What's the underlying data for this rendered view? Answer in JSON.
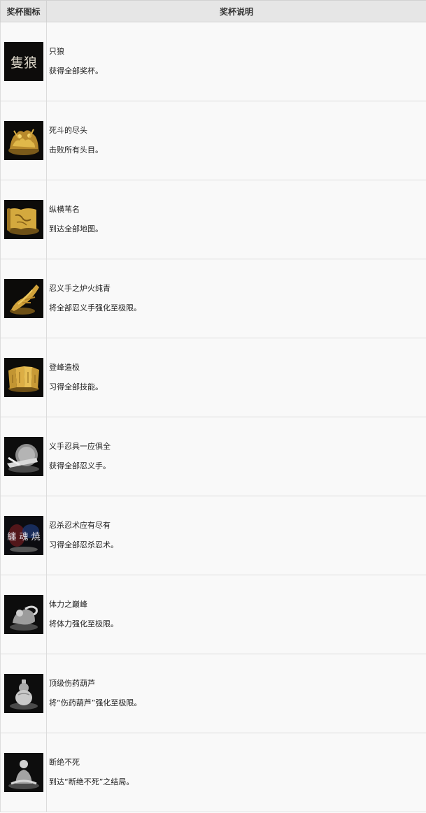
{
  "table": {
    "headers": {
      "icon": "奖杯图标",
      "desc": "奖杯说明"
    },
    "rows": [
      {
        "icon": "calligraphy-logo-icon",
        "icon_text": "隻狼",
        "name": "只狼",
        "desc": "获得全部奖杯。"
      },
      {
        "icon": "gold-warriors-battle-icon",
        "name": "死斗的尽头",
        "desc": "击败所有头目。"
      },
      {
        "icon": "gold-map-scroll-icon",
        "name": "纵横苇名",
        "desc": "到达全部地图。"
      },
      {
        "icon": "gold-prosthetic-arm-icon",
        "name": "忍义手之炉火纯青",
        "desc": "将全部忍义手强化至极限。"
      },
      {
        "icon": "gold-skill-scrolls-icon",
        "name": "登峰造极",
        "desc": "习得全部技能。"
      },
      {
        "icon": "silver-prosthetic-tools-icon",
        "name": "义手忍具一应俱全",
        "desc": "获得全部忍义手。"
      },
      {
        "icon": "silver-ninjutsu-calligraphy-icon",
        "icon_text": "纏 魂 焼",
        "name": "忍杀忍术应有尽有",
        "desc": "习得全部忍杀忍术。"
      },
      {
        "icon": "silver-strong-figure-icon",
        "name": "体力之巅峰",
        "desc": "将体力强化至极限。"
      },
      {
        "icon": "silver-gourd-icon",
        "name": "顶级伤药葫芦",
        "desc": "将“伤药葫芦”强化至极限。"
      },
      {
        "icon": "silver-seated-monk-icon",
        "name": "断绝不死",
        "desc": "到达“断绝不死”之结局。"
      }
    ]
  }
}
